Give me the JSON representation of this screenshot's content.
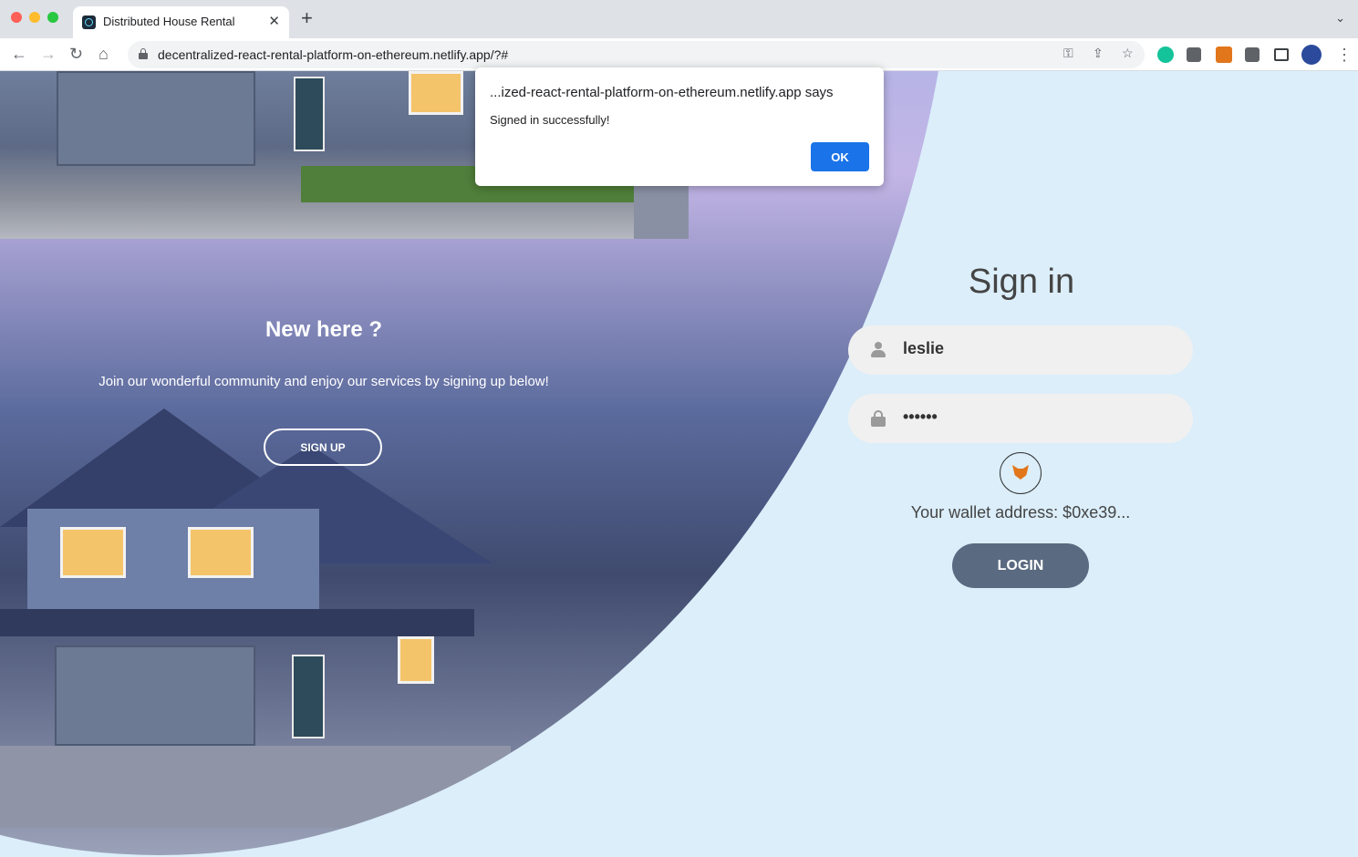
{
  "browser": {
    "tab_title": "Distributed House Rental",
    "tab_close": "✕",
    "new_tab": "+",
    "tab_menu": "⌄",
    "url": "decentralized-react-rental-platform-on-ethereum.netlify.app/?#",
    "nav": {
      "back": "←",
      "forward": "→",
      "reload": "↻",
      "home": "⌂"
    },
    "omnibox_icons": {
      "key": "⚿",
      "share": "⇪",
      "bookmark": "☆"
    },
    "menu": "⋮"
  },
  "left_panel": {
    "title": "New here ?",
    "body": "Join our wonderful community and enjoy our services by signing up below!",
    "signup_label": "SIGN UP"
  },
  "signin": {
    "title": "Sign in",
    "username_value": "leslie",
    "password_value": "••••••",
    "wallet_text": "Your wallet address: $0xe39...",
    "login_label": "LOGIN"
  },
  "dialog": {
    "title": "...ized-react-rental-platform-on-ethereum.netlify.app says",
    "message": "Signed in successfully!",
    "ok_label": "OK"
  },
  "colors": {
    "page_bg": "#dbeefa",
    "login_button": "#5a6a80",
    "ok_button": "#1a73e8"
  }
}
